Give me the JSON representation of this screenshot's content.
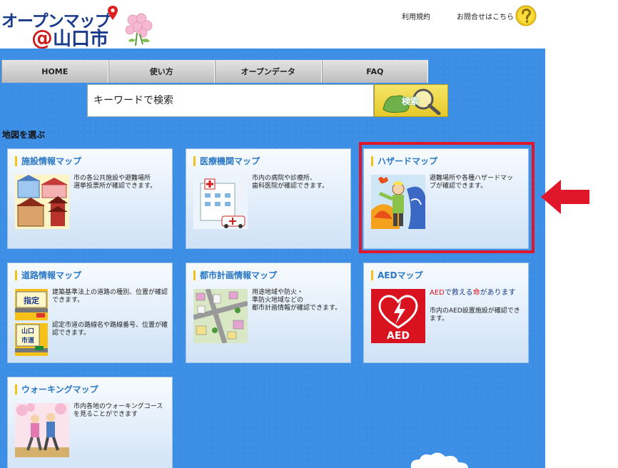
{
  "header": {
    "logo_line1": "オープンマップ",
    "logo_at": "@",
    "logo_line2": "山口市",
    "terms_link": "利用規約",
    "contact_link": "お問合せはこちら ▸"
  },
  "nav": [
    {
      "label": "HOME"
    },
    {
      "label": "使い方"
    },
    {
      "label": "オープンデータ"
    },
    {
      "label": "FAQ"
    }
  ],
  "search": {
    "placeholder": "キーワードで検索",
    "button_label": "検索"
  },
  "section_title": "地図を選ぶ",
  "cards": [
    {
      "title": "施設情報マップ",
      "desc": "市の各公共施設や避難場所\n選挙投票所が確認できます。"
    },
    {
      "title": "医療機関マップ",
      "desc": "市内の病院や診療所、\n歯科医院が確認できます。"
    },
    {
      "title": "ハザードマップ",
      "desc": "避難場所や各種ハザードマッ\nプが確認できます。"
    },
    {
      "title": "道路情報マップ",
      "desc1": "建築基準法上の道路の種別、位置が確認できます。",
      "desc2": "認定市道の路線名や路線番号、位置が確認できます。",
      "sign1": "指定",
      "sign2": "山口\n市道"
    },
    {
      "title": "都市計画情報マップ",
      "desc": "用途地域や防火・\n準防火地域などの\n都市計画情報が確認できます。"
    },
    {
      "title": "AEDマップ",
      "tag_prefix": "AED",
      "tag_mid": "で救える",
      "tag_red": "命",
      "tag_suffix": "があります",
      "desc": "市内のAED設置施設が確認できます。",
      "icon_text": "AED"
    },
    {
      "title": "ウォーキングマップ",
      "desc": "市内各地のウォーキングコースを見ることができます"
    }
  ],
  "colors": {
    "main_bg": "#3d8ee5",
    "card_title": "#2a77c6",
    "highlight": "#e0162b",
    "aed_red": "#d8131f"
  }
}
